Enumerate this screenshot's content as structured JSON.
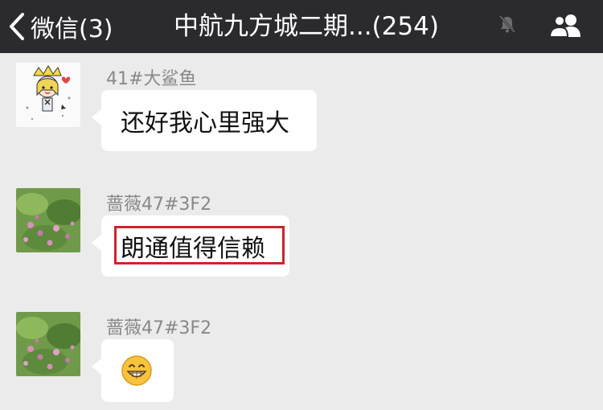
{
  "navbar": {
    "back_label": "微信(3)",
    "title": "中航九方城二期...(254)",
    "icons": {
      "back": "chevron-left-icon",
      "mute": "mute-bell-icon",
      "members": "group-people-icon"
    }
  },
  "messages": [
    {
      "sender": "41#大鲨鱼",
      "text": "还好我心里强大",
      "avatar": "cartoon-girl-avatar"
    },
    {
      "sender": "蔷薇47#3F2",
      "text": "朗通值得信赖",
      "avatar": "flower-photo-avatar",
      "highlighted": true
    },
    {
      "sender": "蔷薇47#3F2",
      "text": "",
      "emoji": "grinning-face-emoji",
      "avatar": "flower-photo-avatar"
    }
  ],
  "colors": {
    "navbar": "#2b2b2f",
    "background": "#ebebeb",
    "bubble": "#ffffff",
    "highlight": "#c8262b"
  }
}
